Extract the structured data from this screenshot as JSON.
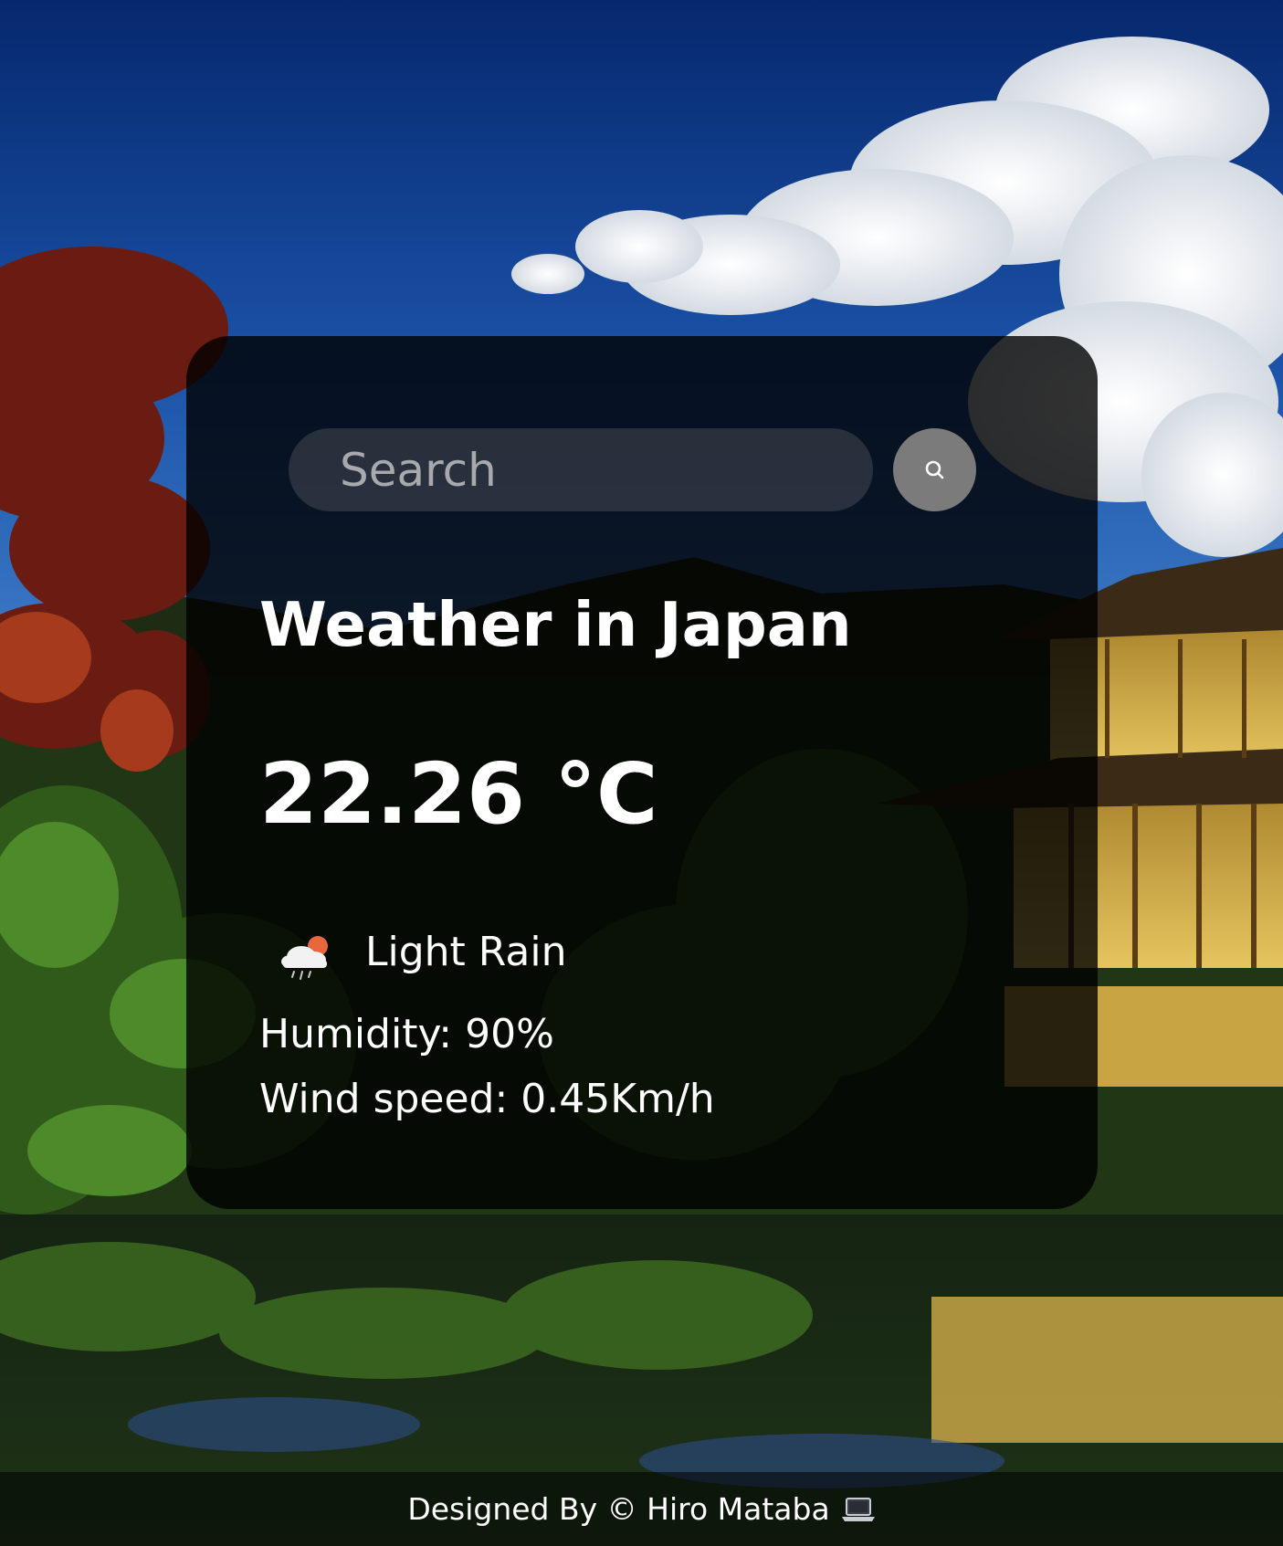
{
  "search": {
    "placeholder": "Search",
    "button_icon": "search-icon"
  },
  "weather": {
    "city_title": "Weather in Japan",
    "temperature": "22.26 °C",
    "condition_icon": "cloud-rain-sun-icon",
    "description": "Light Rain",
    "humidity": "Humidity: 90%",
    "wind_speed": "Wind speed: 0.45Km/h"
  },
  "footer": {
    "text": "Designed By © Hiro Mataba",
    "icon": "laptop-icon"
  },
  "colors": {
    "card_background": "rgba(0,0,0,0.8)",
    "search_button": "#7b7b7b",
    "text": "#ffffff",
    "sun_accent": "#e8673c"
  }
}
